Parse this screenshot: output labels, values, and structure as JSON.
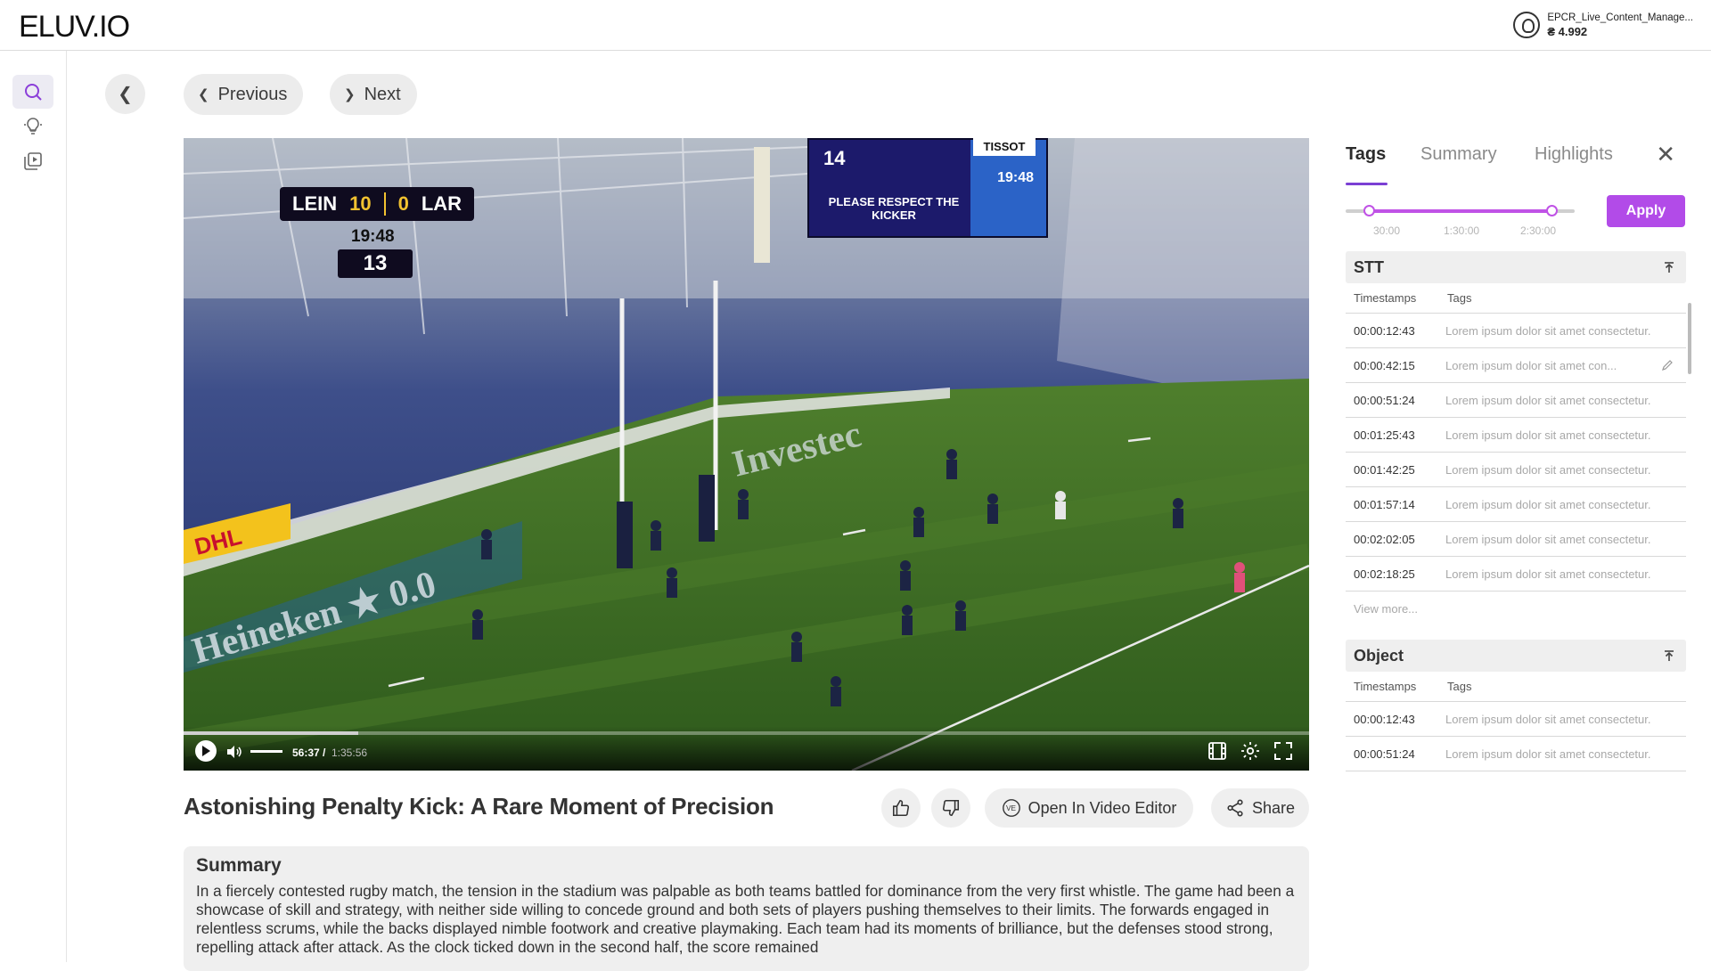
{
  "header": {
    "logo": "ELUV.IO",
    "account_name": "EPCR_Live_Content_Manage...",
    "account_balance": "₴ 4.992"
  },
  "sidebar": {
    "items": [
      {
        "name": "search",
        "active": true
      },
      {
        "name": "lightbulb",
        "active": false
      },
      {
        "name": "media-library",
        "active": false
      }
    ]
  },
  "nav": {
    "previous_label": "Previous",
    "next_label": "Next"
  },
  "video": {
    "scoreboard": {
      "home_team": "LEIN",
      "home_score": "10",
      "away_team": "LAR",
      "away_score": "0",
      "match_clock": "19:48",
      "stat": "13",
      "big_screen_number": "14",
      "big_screen_message": "PLEASE RESPECT THE KICKER",
      "big_screen_brand": "TISSOT",
      "big_screen_time": "19:48"
    },
    "player": {
      "current_time": "56:37 /",
      "total_time": "1:35:56",
      "progress_fraction": 0.155
    }
  },
  "content": {
    "title": "Astonishing Penalty Kick: A Rare Moment of Precision",
    "open_editor_label": "Open In Video Editor",
    "share_label": "Share",
    "summary_heading": "Summary",
    "summary_text": "In a fiercely contested rugby match, the tension in the stadium was palpable as both teams battled for dominance from the very first whistle. The game had been a showcase of skill and strategy, with neither side willing to concede ground and both sets of players pushing themselves to their limits. The forwards engaged in relentless scrums, while the backs displayed nimble footwork and creative playmaking. Each team had its moments of brilliance, but the defenses stood strong, repelling attack after attack. As the clock ticked down in the second half, the score remained"
  },
  "panel": {
    "tabs": [
      "Tags",
      "Summary",
      "Highlights"
    ],
    "active_tab": "Tags",
    "range": {
      "labels": [
        "30:00",
        "1:30:00",
        "2:30:00"
      ],
      "start_fraction": 0.1,
      "end_fraction": 0.9
    },
    "apply_label": "Apply",
    "stt": {
      "title": "STT",
      "col_timestamps": "Timestamps",
      "col_tags": "Tags",
      "rows": [
        {
          "ts": "00:00:12:43",
          "tag": "Lorem ipsum dolor sit amet consectetur."
        },
        {
          "ts": "00:00:42:15",
          "tag": "Lorem ipsum dolor sit amet con..."
        },
        {
          "ts": "00:00:51:24",
          "tag": "Lorem ipsum dolor sit amet consectetur."
        },
        {
          "ts": "00:01:25:43",
          "tag": "Lorem ipsum dolor sit amet consectetur."
        },
        {
          "ts": "00:01:42:25",
          "tag": "Lorem ipsum dolor sit amet consectetur."
        },
        {
          "ts": "00:01:57:14",
          "tag": "Lorem ipsum dolor sit amet consectetur."
        },
        {
          "ts": "00:02:02:05",
          "tag": "Lorem ipsum dolor sit amet consectetur."
        },
        {
          "ts": "00:02:18:25",
          "tag": "Lorem ipsum dolor sit amet consectetur."
        }
      ],
      "view_more": "View more..."
    },
    "object": {
      "title": "Object",
      "col_timestamps": "Timestamps",
      "col_tags": "Tags",
      "rows": [
        {
          "ts": "00:00:12:43",
          "tag": "Lorem ipsum dolor sit amet consectetur."
        },
        {
          "ts": "00:00:51:24",
          "tag": "Lorem ipsum dolor sit amet consectetur."
        }
      ]
    }
  },
  "colors": {
    "accent": "#b24be8",
    "range": "#c052e6",
    "tab_underline": "#7b3fd4"
  }
}
